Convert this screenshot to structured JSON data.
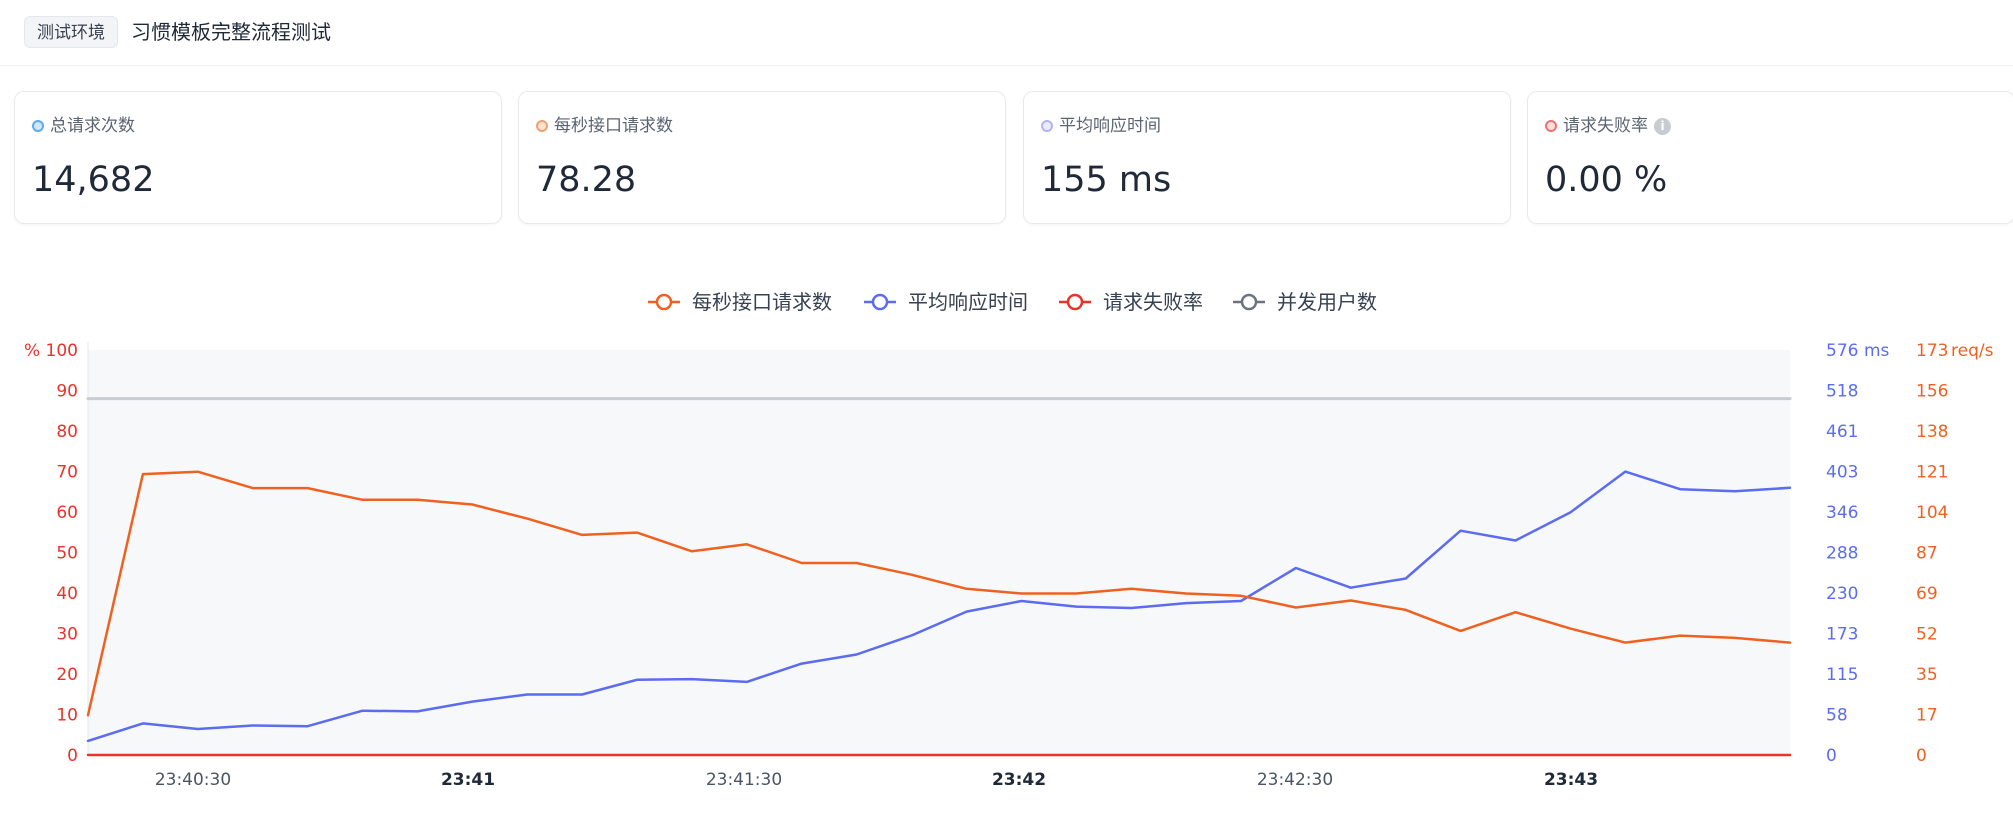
{
  "header": {
    "env_tag": "测试环境",
    "title": "习惯模板完整流程测试"
  },
  "stats": [
    {
      "label": "总请求次数",
      "value": "14,682",
      "color": "#5aa9ef"
    },
    {
      "label": "每秒接口请求数",
      "value": "78.28",
      "color": "#f0a070"
    },
    {
      "label": "平均响应时间",
      "value": "155 ms",
      "color": "#b3b3f0"
    },
    {
      "label": "请求失败率",
      "value": "0.00 %",
      "color": "#f07070",
      "info_icon": "info-icon"
    }
  ],
  "chart_data": {
    "type": "line",
    "legend": [
      {
        "name": "每秒接口请求数",
        "color": "#ef6121"
      },
      {
        "name": "平均响应时间",
        "color": "#5b6cf0"
      },
      {
        "name": "请求失败率",
        "color": "#e8332a"
      },
      {
        "name": "并发用户数",
        "color": "#6b7280"
      }
    ],
    "x_ticks": [
      {
        "label": "23:40:30",
        "bold": false
      },
      {
        "label": "23:41",
        "bold": true
      },
      {
        "label": "23:41:30",
        "bold": false
      },
      {
        "label": "23:42",
        "bold": true
      },
      {
        "label": "23:42:30",
        "bold": false
      },
      {
        "label": "23:43",
        "bold": true
      }
    ],
    "left_axis": {
      "unit": "%",
      "ticks": [
        "0",
        "10",
        "20",
        "30",
        "40",
        "50",
        "60",
        "70",
        "80",
        "90",
        "100"
      ],
      "ylim": [
        0,
        100
      ],
      "color": "#e8332a"
    },
    "mid_axis": {
      "unit": "ms",
      "ticks": [
        "0",
        "58",
        "115",
        "173",
        "230",
        "288",
        "346",
        "403",
        "461",
        "518",
        "576"
      ],
      "ylim": [
        0,
        576
      ],
      "color": "#5b6cf0"
    },
    "right_axis": {
      "unit": "req/s",
      "ticks": [
        "0",
        "17",
        "35",
        "52",
        "69",
        "87",
        "104",
        "121",
        "138",
        "156",
        "173"
      ],
      "ylim": [
        0,
        173
      ],
      "color": "#ef6121"
    },
    "series": [
      {
        "name": "每秒接口请求数",
        "axis": "right",
        "color": "#ef6121",
        "values": [
          17,
          120,
          121,
          114,
          114,
          109,
          109,
          107,
          101,
          94,
          95,
          87,
          90,
          82,
          82,
          77,
          71,
          69,
          69,
          71,
          69,
          68,
          63,
          66,
          62,
          53,
          61,
          54,
          48,
          51,
          50,
          48
        ]
      },
      {
        "name": "平均响应时间",
        "axis": "mid",
        "color": "#5b6cf0",
        "values": [
          20,
          45,
          37,
          42,
          41,
          63,
          62,
          76,
          86,
          86,
          107,
          108,
          104,
          130,
          143,
          170,
          204,
          219,
          211,
          209,
          216,
          219,
          266,
          238,
          251,
          319,
          305,
          345,
          403,
          378,
          375,
          380
        ]
      },
      {
        "name": "请求失败率",
        "axis": "left",
        "color": "#e8332a",
        "values": [
          0,
          0,
          0,
          0,
          0,
          0,
          0,
          0,
          0,
          0,
          0,
          0,
          0,
          0,
          0,
          0,
          0,
          0,
          0,
          0,
          0,
          0,
          0,
          0,
          0,
          0,
          0,
          0,
          0,
          0,
          0,
          0
        ]
      },
      {
        "name": "并发用户数",
        "axis": "left",
        "color": "#c9ccd2",
        "values": [
          88,
          88,
          88,
          88,
          88,
          88,
          88,
          88,
          88,
          88,
          88,
          88,
          88,
          88,
          88,
          88,
          88,
          88,
          88,
          88,
          88,
          88,
          88,
          88,
          88,
          88,
          88,
          88,
          88,
          88,
          88,
          88
        ]
      }
    ]
  }
}
